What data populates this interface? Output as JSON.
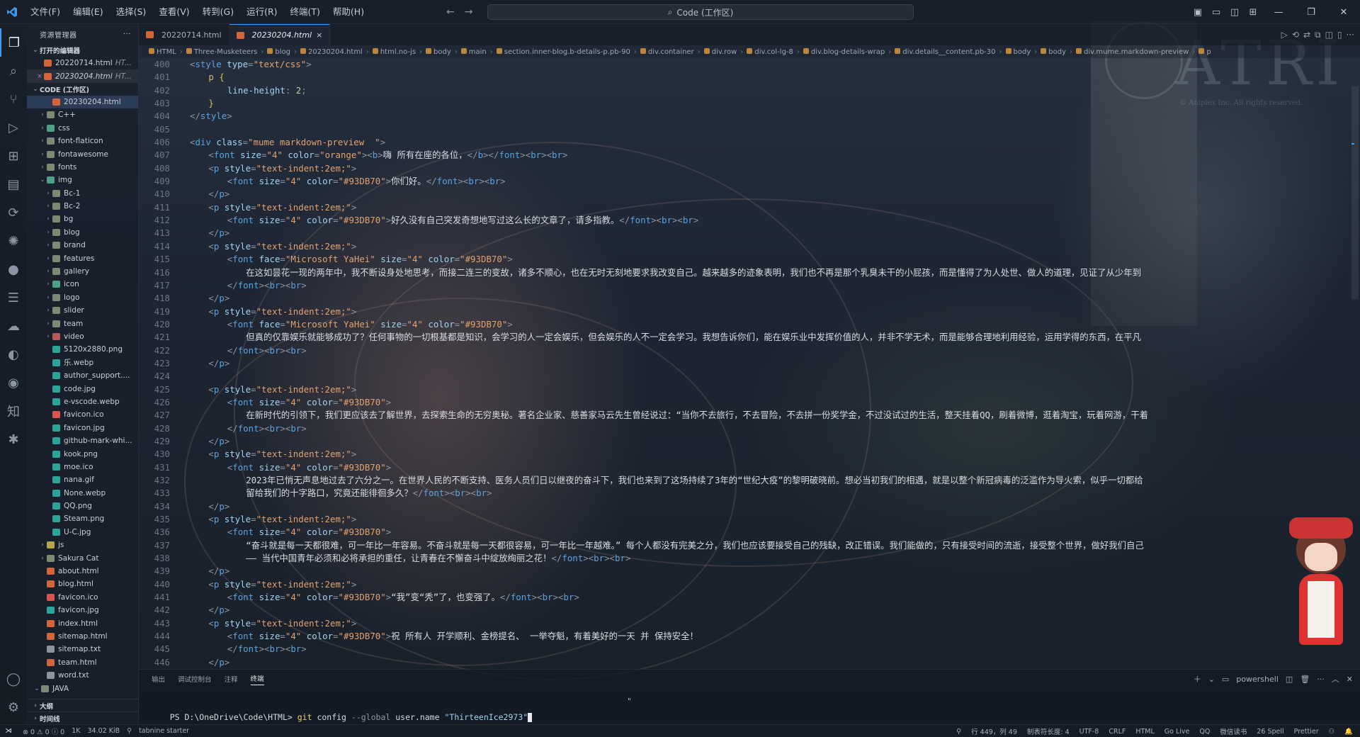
{
  "titlebar": {
    "menu": [
      "文件(F)",
      "编辑(E)",
      "选择(S)",
      "查看(V)",
      "转到(G)",
      "运行(R)",
      "终端(T)",
      "帮助(H)"
    ],
    "command_center": "Code (工作区)"
  },
  "sidebar": {
    "title": "资源管理器",
    "open_editors_label": "打开的编辑器",
    "open_editors": [
      {
        "name": "20220714.html",
        "desc": "HT..."
      },
      {
        "name": "20230204.html",
        "desc": "HT..."
      }
    ],
    "workspace_label": "CODE (工作区)",
    "tree": [
      {
        "name": "20230204.html",
        "type": "html",
        "depth": 3,
        "selected": true
      },
      {
        "name": "C++",
        "type": "folder",
        "depth": 2,
        "chev": "›"
      },
      {
        "name": "css",
        "type": "folder-img",
        "depth": 2,
        "chev": "›"
      },
      {
        "name": "font-flaticon",
        "type": "folder",
        "depth": 2,
        "chev": "›"
      },
      {
        "name": "fontawesome",
        "type": "folder",
        "depth": 2,
        "chev": "›"
      },
      {
        "name": "fonts",
        "type": "folder",
        "depth": 2,
        "chev": "›"
      },
      {
        "name": "img",
        "type": "folder-img",
        "depth": 2,
        "chev": "⌄"
      },
      {
        "name": "Bc-1",
        "type": "folder",
        "depth": 3,
        "chev": "›"
      },
      {
        "name": "Bc-2",
        "type": "folder",
        "depth": 3,
        "chev": "›"
      },
      {
        "name": "bg",
        "type": "folder",
        "depth": 3,
        "chev": "›"
      },
      {
        "name": "blog",
        "type": "folder",
        "depth": 3,
        "chev": "›"
      },
      {
        "name": "brand",
        "type": "folder",
        "depth": 3,
        "chev": "›"
      },
      {
        "name": "features",
        "type": "folder",
        "depth": 3,
        "chev": "›"
      },
      {
        "name": "gallery",
        "type": "folder",
        "depth": 3,
        "chev": "›"
      },
      {
        "name": "icon",
        "type": "folder-img",
        "depth": 3,
        "chev": "›"
      },
      {
        "name": "logo",
        "type": "folder",
        "depth": 3,
        "chev": "›"
      },
      {
        "name": "slider",
        "type": "folder",
        "depth": 3,
        "chev": "›"
      },
      {
        "name": "team",
        "type": "folder",
        "depth": 3,
        "chev": "›"
      },
      {
        "name": "video",
        "type": "folder-red",
        "depth": 3,
        "chev": "›"
      },
      {
        "name": "5120x2880.png",
        "type": "img",
        "depth": 3
      },
      {
        "name": "乐.webp",
        "type": "img",
        "depth": 3
      },
      {
        "name": "author_support....",
        "type": "img",
        "depth": 3
      },
      {
        "name": "code.jpg",
        "type": "img",
        "depth": 3
      },
      {
        "name": "e-vscode.webp",
        "type": "img",
        "depth": 3
      },
      {
        "name": "favicon.ico",
        "type": "ico",
        "depth": 3
      },
      {
        "name": "favicon.jpg",
        "type": "img",
        "depth": 3
      },
      {
        "name": "github-mark-whi...",
        "type": "img",
        "depth": 3
      },
      {
        "name": "kook.png",
        "type": "img",
        "depth": 3
      },
      {
        "name": "moe.ico",
        "type": "img",
        "depth": 3
      },
      {
        "name": "nana.gif",
        "type": "img",
        "depth": 3
      },
      {
        "name": "None.webp",
        "type": "img",
        "depth": 3
      },
      {
        "name": "QQ.png",
        "type": "img",
        "depth": 3
      },
      {
        "name": "Steam.png",
        "type": "img",
        "depth": 3
      },
      {
        "name": "U-C.jpg",
        "type": "img",
        "depth": 3
      },
      {
        "name": "js",
        "type": "folder-js",
        "depth": 2,
        "chev": "›"
      },
      {
        "name": "Sakura Cat",
        "type": "folder",
        "depth": 2,
        "chev": "›"
      },
      {
        "name": "about.html",
        "type": "html",
        "depth": 2
      },
      {
        "name": "blog.html",
        "type": "html",
        "depth": 2
      },
      {
        "name": "favicon.ico",
        "type": "ico",
        "depth": 2
      },
      {
        "name": "favicon.jpg",
        "type": "img",
        "depth": 2
      },
      {
        "name": "index.html",
        "type": "html",
        "depth": 2
      },
      {
        "name": "sitemap.html",
        "type": "html",
        "depth": 2
      },
      {
        "name": "sitemap.txt",
        "type": "txt",
        "depth": 2
      },
      {
        "name": "team.html",
        "type": "html",
        "depth": 2
      },
      {
        "name": "word.txt",
        "type": "txt",
        "depth": 2
      },
      {
        "name": "JAVA",
        "type": "folder",
        "depth": 1,
        "chev": "⌄"
      }
    ],
    "outline_label": "大纲",
    "timeline_label": "时间线"
  },
  "tabs": [
    {
      "name": "20220714.html",
      "active": false
    },
    {
      "name": "20230204.html",
      "active": true,
      "close": "×"
    }
  ],
  "breadcrumb": [
    "HTML",
    "Three-Musketeers",
    "blog",
    "20230204.html",
    "html.no-js",
    "body",
    "main",
    "section.inner-blog.b-details-p.pb-90",
    "div.container",
    "div.row",
    "div.col-lg-8",
    "div.blog-details-wrap",
    "div.details__content.pb-30",
    "body",
    "body",
    "div.mume.markdown-preview",
    "p"
  ],
  "editor": {
    "lines": [
      {
        "n": "400",
        "h": "<span class='t-punc'>&lt;</span><span class='t-tag'>style</span> <span class='t-attr'>type</span><span class='t-punc'>=</span><span class='t-str'>\"text/css\"</span><span class='t-punc'>&gt;</span>",
        "i": 0
      },
      {
        "n": "401",
        "h": "<span class='t-sel'>p</span> <span class='t-brace'>{</span>",
        "i": 1
      },
      {
        "n": "402",
        "h": "<span class='t-prop'>line-height</span><span class='t-punc'>:</span> <span class='t-num'>2</span><span class='t-punc'>;</span>",
        "i": 2
      },
      {
        "n": "403",
        "h": "<span class='t-brace'>}</span>",
        "i": 1
      },
      {
        "n": "404",
        "h": "<span class='t-punc'>&lt;/</span><span class='t-tag'>style</span><span class='t-punc'>&gt;</span>",
        "i": 0
      },
      {
        "n": "405",
        "h": "",
        "i": 0
      },
      {
        "n": "406",
        "h": "<span class='t-punc'>&lt;</span><span class='t-tag'>div</span> <span class='t-attr'>class</span><span class='t-punc'>=</span><span class='t-str'>\"mume markdown-preview  \"</span><span class='t-punc'>&gt;</span>",
        "i": 0
      },
      {
        "n": "407",
        "h": "<span class='t-punc'>&lt;</span><span class='t-tag'>font</span> <span class='t-attr'>size</span><span class='t-punc'>=</span><span class='t-str'>\"4\"</span> <span class='t-attr'>color</span><span class='t-punc'>=</span><span class='t-str'>\"orange\"</span><span class='t-punc'>&gt;&lt;</span><span class='t-tag'>b</span><span class='t-punc'>&gt;</span><span class='t-txt'>嗨 所有在座的各位，</span><span class='t-punc'>&lt;/</span><span class='t-tag'>b</span><span class='t-punc'>&gt;&lt;/</span><span class='t-tag'>font</span><span class='t-punc'>&gt;&lt;</span><span class='t-tag'>br</span><span class='t-punc'>&gt;&lt;</span><span class='t-tag'>br</span><span class='t-punc'>&gt;</span>",
        "i": 1
      },
      {
        "n": "408",
        "h": "<span class='t-punc'>&lt;</span><span class='t-tag'>p</span> <span class='t-attr'>style</span><span class='t-punc'>=</span><span class='t-str'>\"text-indent:2em;\"</span><span class='t-punc'>&gt;</span>",
        "i": 1
      },
      {
        "n": "409",
        "h": "<span class='t-punc'>&lt;</span><span class='t-tag'>font</span> <span class='t-attr'>size</span><span class='t-punc'>=</span><span class='t-str'>\"4\"</span> <span class='t-attr'>color</span><span class='t-punc'>=</span><span class='t-str'>\"#93DB70\"</span><span class='t-punc'>&gt;</span><span class='t-txt'>你们好。</span><span class='t-punc'>&lt;/</span><span class='t-tag'>font</span><span class='t-punc'>&gt;&lt;</span><span class='t-tag'>br</span><span class='t-punc'>&gt;&lt;</span><span class='t-tag'>br</span><span class='t-punc'>&gt;</span>",
        "i": 2
      },
      {
        "n": "410",
        "h": "<span class='t-punc'>&lt;/</span><span class='t-tag'>p</span><span class='t-punc'>&gt;</span>",
        "i": 1
      },
      {
        "n": "411",
        "h": "<span class='t-punc'>&lt;</span><span class='t-tag'>p</span> <span class='t-attr'>style</span><span class='t-punc'>=</span><span class='t-str'>\"text-indent:2em;\"</span><span class='t-punc'>&gt;</span>",
        "i": 1
      },
      {
        "n": "412",
        "h": "<span class='t-punc'>&lt;</span><span class='t-tag'>font</span> <span class='t-attr'>size</span><span class='t-punc'>=</span><span class='t-str'>\"4\"</span> <span class='t-attr'>color</span><span class='t-punc'>=</span><span class='t-str'>\"#93DB70\"</span><span class='t-punc'>&gt;</span><span class='t-txt'>好久没有自己突发奇想地写过这么长的文章了，请多指教。</span><span class='t-punc'>&lt;/</span><span class='t-tag'>font</span><span class='t-punc'>&gt;&lt;</span><span class='t-tag'>br</span><span class='t-punc'>&gt;&lt;</span><span class='t-tag'>br</span><span class='t-punc'>&gt;</span>",
        "i": 2
      },
      {
        "n": "413",
        "h": "<span class='t-punc'>&lt;/</span><span class='t-tag'>p</span><span class='t-punc'>&gt;</span>",
        "i": 1
      },
      {
        "n": "414",
        "h": "<span class='t-punc'>&lt;</span><span class='t-tag'>p</span> <span class='t-attr'>style</span><span class='t-punc'>=</span><span class='t-str'>\"text-indent:2em;\"</span><span class='t-punc'>&gt;</span>",
        "i": 1
      },
      {
        "n": "415",
        "h": "<span class='t-punc'>&lt;</span><span class='t-tag'>font</span> <span class='t-attr'>face</span><span class='t-punc'>=</span><span class='t-str'>\"Microsoft YaHei\"</span> <span class='t-attr'>size</span><span class='t-punc'>=</span><span class='t-str'>\"4\"</span> <span class='t-attr'>color</span><span class='t-punc'>=</span><span class='t-str'>\"#93DB70\"</span><span class='t-punc'>&gt;</span>",
        "i": 2
      },
      {
        "n": "416",
        "h": "<span class='t-txt'>在这如昙花一现的两年中，我不断设身处地思考，而接二连三的变故，诸多不顺心，也在无时无刻地要求我改变自己。越来越多的迹象表明，我们也不再是那个乳臭未干的小屁孩，而是懂得了为人处世、做人的道理，见证了从少年到</span>",
        "i": 3
      },
      {
        "n": "417",
        "h": "<span class='t-punc'>&lt;/</span><span class='t-tag'>font</span><span class='t-punc'>&gt;&lt;</span><span class='t-tag'>br</span><span class='t-punc'>&gt;&lt;</span><span class='t-tag'>br</span><span class='t-punc'>&gt;</span>",
        "i": 2
      },
      {
        "n": "418",
        "h": "<span class='t-punc'>&lt;/</span><span class='t-tag'>p</span><span class='t-punc'>&gt;</span>",
        "i": 1
      },
      {
        "n": "419",
        "h": "<span class='t-punc'>&lt;</span><span class='t-tag'>p</span> <span class='t-attr'>style</span><span class='t-punc'>=</span><span class='t-str'>\"text-indent:2em;\"</span><span class='t-punc'>&gt;</span>",
        "i": 1
      },
      {
        "n": "420",
        "h": "<span class='t-punc'>&lt;</span><span class='t-tag'>font</span> <span class='t-attr'>face</span><span class='t-punc'>=</span><span class='t-str'>\"Microsoft YaHei\"</span> <span class='t-attr'>size</span><span class='t-punc'>=</span><span class='t-str'>\"4\"</span> <span class='t-attr'>color</span><span class='t-punc'>=</span><span class='t-str'>\"#93DB70\"</span><span class='t-punc'>&gt;</span>",
        "i": 2
      },
      {
        "n": "421",
        "h": "<span class='t-txt'>但真的仅靠娱乐就能够成功了？任何事物的一切根基都是知识，会学习的人一定会娱乐，但会娱乐的人不一定会学习。我想告诉你们，能在娱乐业中发挥价值的人，并非不学无术，而是能够合理地利用经验，运用学得的东西，在平凡</span>",
        "i": 3
      },
      {
        "n": "422",
        "h": "<span class='t-punc'>&lt;/</span><span class='t-tag'>font</span><span class='t-punc'>&gt;&lt;</span><span class='t-tag'>br</span><span class='t-punc'>&gt;&lt;</span><span class='t-tag'>br</span><span class='t-punc'>&gt;</span>",
        "i": 2
      },
      {
        "n": "423",
        "h": "<span class='t-punc'>&lt;/</span><span class='t-tag'>p</span><span class='t-punc'>&gt;</span>",
        "i": 1
      },
      {
        "n": "424",
        "h": "",
        "i": 0
      },
      {
        "n": "425",
        "h": "<span class='t-punc'>&lt;</span><span class='t-tag'>p</span> <span class='t-attr'>style</span><span class='t-punc'>=</span><span class='t-str'>\"text-indent:2em;\"</span><span class='t-punc'>&gt;</span>",
        "i": 1
      },
      {
        "n": "426",
        "h": "<span class='t-punc'>&lt;</span><span class='t-tag'>font</span> <span class='t-attr'>size</span><span class='t-punc'>=</span><span class='t-str'>\"4\"</span> <span class='t-attr'>color</span><span class='t-punc'>=</span><span class='t-str'>\"#93DB70\"</span><span class='t-punc'>&gt;</span>",
        "i": 2
      },
      {
        "n": "427",
        "h": "<span class='t-txt'>在新时代的引领下，我们更应该去了解世界，去探索生命的无穷奥秘。著名企业家、慈善家马云先生曾经说过：“当你不去旅行，不去冒险，不去拼一份奖学金，不过没试过的生活，整天挂着QQ，刷着微博，逛着淘宝，玩着网游，干着</span>",
        "i": 3
      },
      {
        "n": "428",
        "h": "<span class='t-punc'>&lt;/</span><span class='t-tag'>font</span><span class='t-punc'>&gt;&lt;</span><span class='t-tag'>br</span><span class='t-punc'>&gt;&lt;</span><span class='t-tag'>br</span><span class='t-punc'>&gt;</span>",
        "i": 2
      },
      {
        "n": "429",
        "h": "<span class='t-punc'>&lt;/</span><span class='t-tag'>p</span><span class='t-punc'>&gt;</span>",
        "i": 1
      },
      {
        "n": "430",
        "h": "<span class='t-punc'>&lt;</span><span class='t-tag'>p</span> <span class='t-attr'>style</span><span class='t-punc'>=</span><span class='t-str'>\"text-indent:2em;\"</span><span class='t-punc'>&gt;</span>",
        "i": 1
      },
      {
        "n": "431",
        "h": "<span class='t-punc'>&lt;</span><span class='t-tag'>font</span> <span class='t-attr'>size</span><span class='t-punc'>=</span><span class='t-str'>\"4\"</span> <span class='t-attr'>color</span><span class='t-punc'>=</span><span class='t-str'>\"#93DB70\"</span><span class='t-punc'>&gt;</span>",
        "i": 2
      },
      {
        "n": "432",
        "h": "<span class='t-txt'>2023年已悄无声息地过去了六分之一。在世界人民的不断支持、医务人员们日以继夜的奋斗下，我们也来到了这场持续了3年的“世纪大疫”的黎明破晓前。想必当初我们的相遇，就是以整个新冠病毒的泛滥作为导火索，似乎一切都给</span>",
        "i": 3
      },
      {
        "n": "433",
        "h": "<span class='t-txt'>留给我们的十字路口，究竟还能徘徊多久？</span><span class='t-punc'>&lt;/</span><span class='t-tag'>font</span><span class='t-punc'>&gt;&lt;</span><span class='t-tag'>br</span><span class='t-punc'>&gt;&lt;</span><span class='t-tag'>br</span><span class='t-punc'>&gt;</span>",
        "i": 3
      },
      {
        "n": "434",
        "h": "<span class='t-punc'>&lt;/</span><span class='t-tag'>p</span><span class='t-punc'>&gt;</span>",
        "i": 1
      },
      {
        "n": "435",
        "h": "<span class='t-punc'>&lt;</span><span class='t-tag'>p</span> <span class='t-attr'>style</span><span class='t-punc'>=</span><span class='t-str'>\"text-indent:2em;\"</span><span class='t-punc'>&gt;</span>",
        "i": 1
      },
      {
        "n": "436",
        "h": "<span class='t-punc'>&lt;</span><span class='t-tag'>font</span> <span class='t-attr'>size</span><span class='t-punc'>=</span><span class='t-str'>\"4\"</span> <span class='t-attr'>color</span><span class='t-punc'>=</span><span class='t-str'>\"#93DB70\"</span><span class='t-punc'>&gt;</span>",
        "i": 2
      },
      {
        "n": "437",
        "h": "<span class='t-txt'>“奋斗就是每一天都很难，可一年比一年容易。不奋斗就是每一天都很容易，可一年比一年越难。” 每个人都没有完美之分，我们也应该要接受自己的残缺，改正错误。我们能做的，只有接受时间的流逝，接受整个世界，做好我们自己</span>",
        "i": 3
      },
      {
        "n": "438",
        "h": "<span class='t-txt'>—— 当代中国青年必须和必将承担的重任，让青春在不懈奋斗中绽放绚丽之花！</span><span class='t-punc'>&lt;/</span><span class='t-tag'>font</span><span class='t-punc'>&gt;&lt;</span><span class='t-tag'>br</span><span class='t-punc'>&gt;&lt;</span><span class='t-tag'>br</span><span class='t-punc'>&gt;</span>",
        "i": 3
      },
      {
        "n": "439",
        "h": "<span class='t-punc'>&lt;/</span><span class='t-tag'>p</span><span class='t-punc'>&gt;</span>",
        "i": 1
      },
      {
        "n": "440",
        "h": "<span class='t-punc'>&lt;</span><span class='t-tag'>p</span> <span class='t-attr'>style</span><span class='t-punc'>=</span><span class='t-str'>\"text-indent:2em;\"</span><span class='t-punc'>&gt;</span>",
        "i": 1
      },
      {
        "n": "441",
        "h": "<span class='t-punc'>&lt;</span><span class='t-tag'>font</span> <span class='t-attr'>size</span><span class='t-punc'>=</span><span class='t-str'>\"4\"</span> <span class='t-attr'>color</span><span class='t-punc'>=</span><span class='t-str'>\"#93DB70\"</span><span class='t-punc'>&gt;</span><span class='t-txt'>“我”变“秃”了，也变强了。</span><span class='t-punc'>&lt;/</span><span class='t-tag'>font</span><span class='t-punc'>&gt;&lt;</span><span class='t-tag'>br</span><span class='t-punc'>&gt;&lt;</span><span class='t-tag'>br</span><span class='t-punc'>&gt;</span>",
        "i": 2
      },
      {
        "n": "442",
        "h": "<span class='t-punc'>&lt;/</span><span class='t-tag'>p</span><span class='t-punc'>&gt;</span>",
        "i": 1
      },
      {
        "n": "443",
        "h": "<span class='t-punc'>&lt;</span><span class='t-tag'>p</span> <span class='t-attr'>style</span><span class='t-punc'>=</span><span class='t-str'>\"text-indent:2em;\"</span><span class='t-punc'>&gt;</span>",
        "i": 1
      },
      {
        "n": "444",
        "h": "<span class='t-punc'>&lt;</span><span class='t-tag'>font</span> <span class='t-attr'>size</span><span class='t-punc'>=</span><span class='t-str'>\"4\"</span> <span class='t-attr'>color</span><span class='t-punc'>=</span><span class='t-str'>\"#93DB70\"</span><span class='t-punc'>&gt;</span><span class='t-txt'>祝 所有人 开学顺利、金榜提名、 一举夺魁，有着美好的一天 并 保持安全！</span>",
        "i": 2
      },
      {
        "n": "445",
        "h": "<span class='t-punc'>&lt;/</span><span class='t-tag'>font</span><span class='t-punc'>&gt;&lt;</span><span class='t-tag'>br</span><span class='t-punc'>&gt;&lt;</span><span class='t-tag'>br</span><span class='t-punc'>&gt;</span>",
        "i": 2
      },
      {
        "n": "446",
        "h": "<span class='t-punc'>&lt;/</span><span class='t-tag'>p</span><span class='t-punc'>&gt;</span>",
        "i": 1
      }
    ]
  },
  "panel": {
    "tabs": [
      "输出",
      "调试控制台",
      "注释",
      "终端"
    ],
    "active_tab": "终端",
    "shell": "powershell",
    "prompt": "PS D:\\OneDrive\\Code\\HTML>",
    "command": "git",
    "subcommand": " config ",
    "flag": "--global",
    "arg": " user.name ",
    "value": "\"ThirteenIce2973\"",
    "stray_quote": "\""
  },
  "statusbar": {
    "problems": "⊗ 0 ⚠ 0 ⓘ 0",
    "count": "1K",
    "size": "34.02 KiB",
    "extension": "tabnine starter",
    "position": "行 449，列 49",
    "indent": "制表符长度: 4",
    "encoding": "UTF-8",
    "eol": "CRLF",
    "language": "HTML",
    "golive": "Go Live",
    "qq": "QQ",
    "wechat": "微信读书",
    "spell": "26 Spell",
    "prettier": "Prettier"
  },
  "watermark": "ATRI",
  "watermark_sub": "© Aniplex Inc. All rights reserved."
}
